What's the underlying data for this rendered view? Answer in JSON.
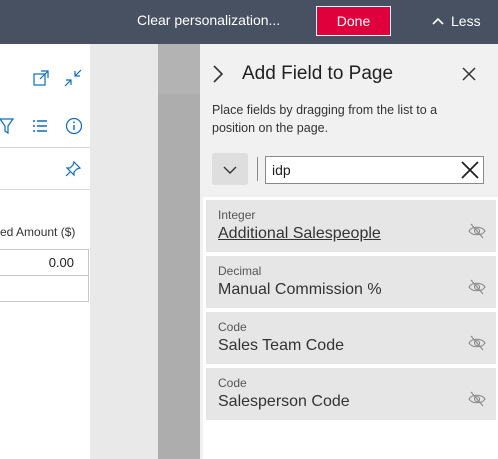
{
  "topbar": {
    "clear_label": "Clear personalization...",
    "done_label": "Done",
    "less_label": "Less"
  },
  "page": {
    "amount_label": "ed Amount ($)",
    "amount_value": "0.00",
    "icons": [
      "popout-icon",
      "collapse-icon",
      "filter-icon",
      "list-icon",
      "info-icon",
      "pin-icon"
    ]
  },
  "pane": {
    "title": "Add Field to Page",
    "help": "Place fields by dragging from the list to a position on the page.",
    "search_value": "idp",
    "fields": [
      {
        "type": "Integer",
        "name": "Additional Salespeople"
      },
      {
        "type": "Decimal",
        "name": "Manual Commission %"
      },
      {
        "type": "Code",
        "name": "Sales Team Code"
      },
      {
        "type": "Code",
        "name": "Salesperson Code"
      }
    ]
  },
  "colors": {
    "topbar": "#475161",
    "done_button": "#e0003b",
    "pane_background": "#f1f1f1",
    "field_item": "#e6e6e6"
  }
}
